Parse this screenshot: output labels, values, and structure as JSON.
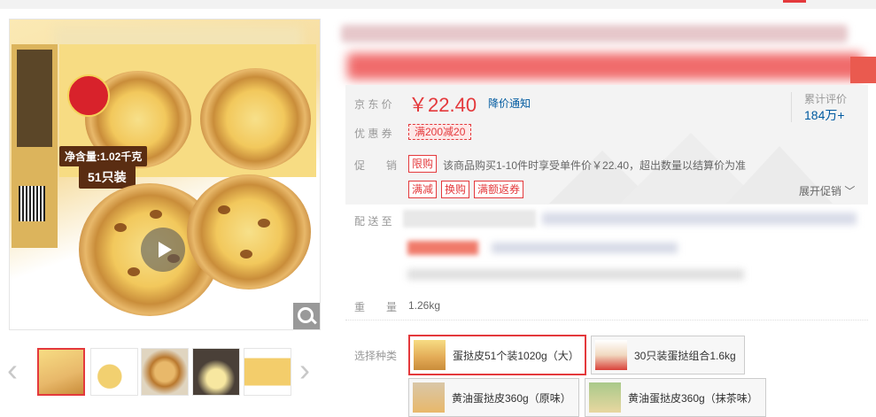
{
  "gallery": {
    "product_label_weight": "净含量:1.02千克",
    "product_label_count": "51只装",
    "thumbs_count": 5
  },
  "summary": {
    "price_label": "京 东 价",
    "price": "￥22.40",
    "notify_label": "降价通知",
    "review_label": "累计评价",
    "review_count": "184万+",
    "coupon_label": "优 惠 券",
    "coupon": "满200减20",
    "promo_label": "促　　销",
    "promo_tag_limit": "限购",
    "promo_text": "该商品购买1-10件时享受单件价￥22.40，超出数量以结算价为准",
    "promo_tags": [
      "满减",
      "换购",
      "满额返券"
    ],
    "expand_label": "展开促销"
  },
  "shipping": {
    "label": "配 送 至"
  },
  "weight": {
    "label": "重　　量",
    "value": "1.26kg"
  },
  "variants": {
    "label": "选择种类",
    "items": [
      {
        "name": "蛋挞皮51个装1020g（大）",
        "selected": true
      },
      {
        "name": "30只装蛋挞组合1.6kg",
        "selected": false
      },
      {
        "name": "黄油蛋挞皮360g（原味）",
        "selected": false
      },
      {
        "name": "黄油蛋挞皮360g（抹茶味）",
        "selected": false
      }
    ]
  },
  "colors": {
    "accent_red": "#e4393c",
    "link_blue": "#005aa0"
  }
}
